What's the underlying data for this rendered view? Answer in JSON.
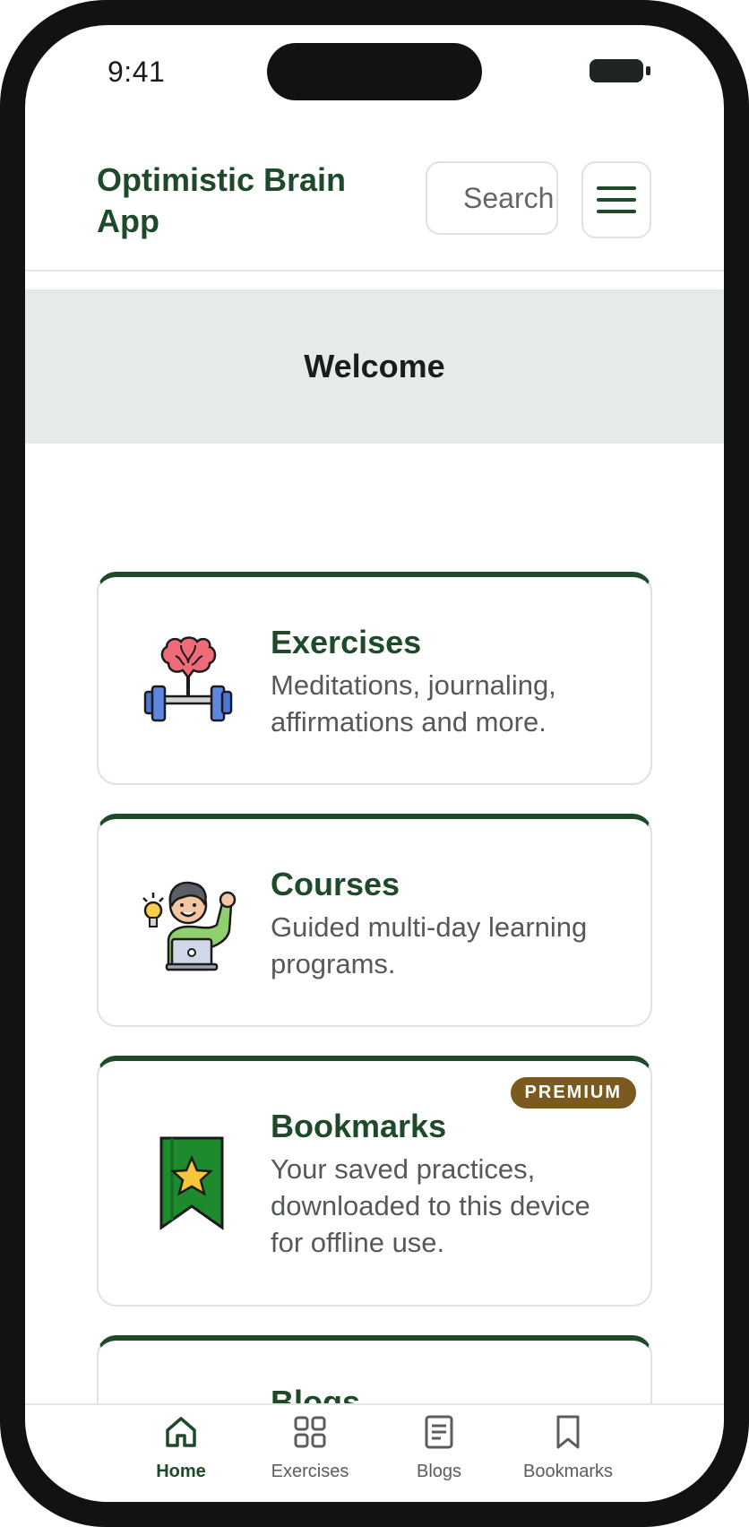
{
  "status_bar": {
    "time": "9:41"
  },
  "header": {
    "title": "Optimistic Brain App",
    "search_placeholder": "Search"
  },
  "welcome": {
    "title": "Welcome"
  },
  "cards": [
    {
      "title": "Exercises",
      "description": "Meditations, journaling, affirmations and more."
    },
    {
      "title": "Courses",
      "description": "Guided multi-day learning programs."
    },
    {
      "title": "Bookmarks",
      "description": "Your saved practices, downloaded to this device for offline use.",
      "badge": "PREMIUM"
    },
    {
      "title": "Blogs"
    }
  ],
  "tabbar": {
    "items": [
      {
        "label": "Home",
        "icon": "home-icon",
        "active": true
      },
      {
        "label": "Exercises",
        "icon": "grid-icon"
      },
      {
        "label": "Blogs",
        "icon": "document-icon"
      },
      {
        "label": "Bookmarks",
        "icon": "bookmark-icon"
      }
    ]
  },
  "colors": {
    "brand_green": "#1e4a2a",
    "welcome_bg": "#e5ece7",
    "premium_badge": "#7a5a1e"
  }
}
